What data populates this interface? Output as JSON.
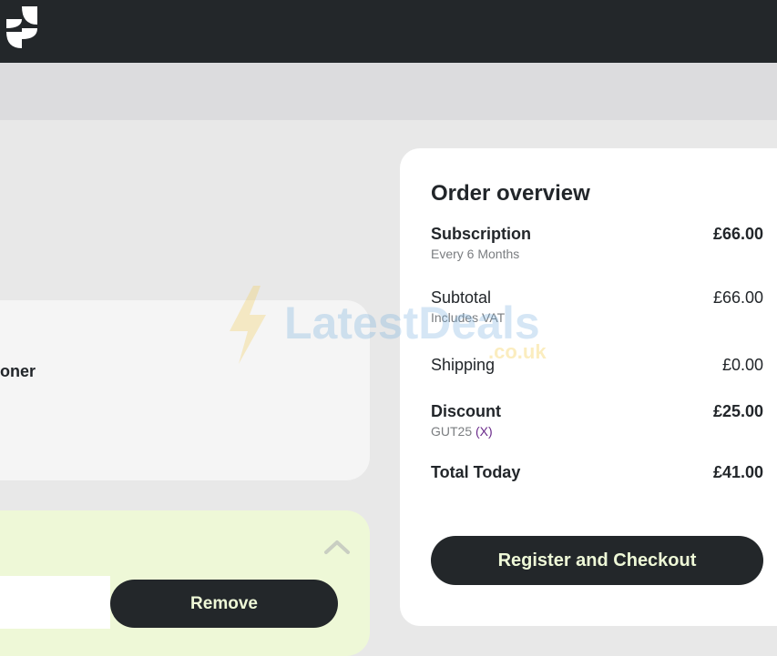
{
  "header": {
    "logo_icon": "brand-logo-icon"
  },
  "product_card": {
    "title_fragment": "oner"
  },
  "promo_card": {
    "collapse_icon": "chevron-up-icon",
    "code_input_value": "",
    "remove_label": "Remove"
  },
  "order_overview": {
    "title": "Order overview",
    "subscription": {
      "label": "Subscription",
      "amount": "£66.00",
      "note": "Every 6 Months"
    },
    "subtotal": {
      "label": "Subtotal",
      "amount": "£66.00",
      "note": "Includes VAT"
    },
    "shipping": {
      "label": "Shipping",
      "amount": "£0.00"
    },
    "discount": {
      "label": "Discount",
      "amount": "£25.00",
      "code": "GUT25",
      "remove_link": "(X)"
    },
    "total": {
      "label": "Total Today",
      "amount": "£41.00"
    },
    "checkout_label": "Register and Checkout"
  },
  "watermark": {
    "brand": "LatestDeals",
    "domain": ".co.uk"
  },
  "colors": {
    "dark": "#23272a",
    "page_bg": "#e8e8e8",
    "promo_bg": "#eef8d7",
    "button_text": "#eef8d7",
    "link_purple": "#6a2a8a"
  }
}
